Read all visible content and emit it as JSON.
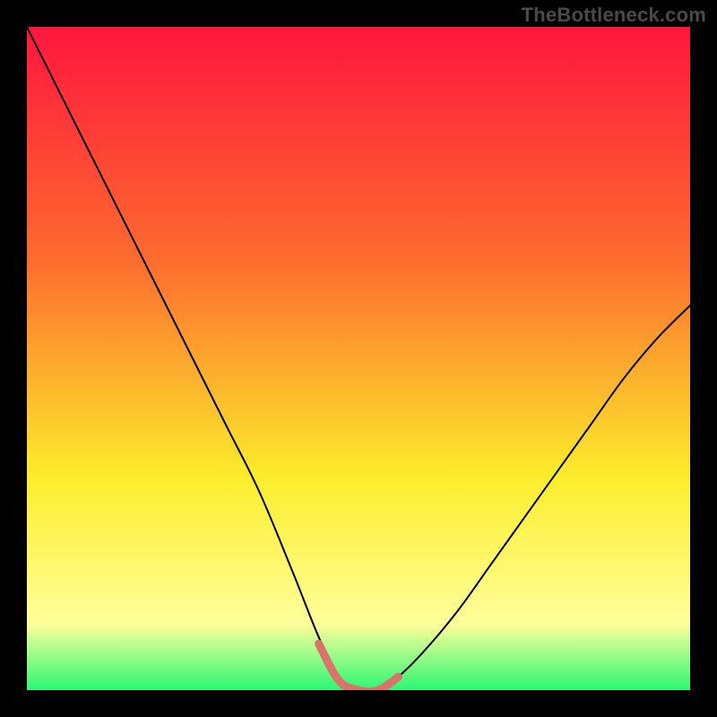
{
  "watermark": "TheBottleneck.com",
  "colors": {
    "background_frame": "#000000",
    "gradient_top": "#ff163e",
    "gradient_mid1": "#fd6b2f",
    "gradient_mid2": "#fced2c",
    "gradient_bottom_yellow": "#ffff9b",
    "gradient_bottom_green": "#2cf774",
    "curve_stroke": "#000000",
    "marker_stroke": "#d9736b"
  },
  "chart_data": {
    "type": "line",
    "title": "",
    "xlabel": "",
    "ylabel": "",
    "xlim": [
      0,
      100
    ],
    "ylim": [
      0,
      100
    ],
    "grid": false,
    "legend": false,
    "series": [
      {
        "name": "bottleneck-curve",
        "x": [
          0,
          5,
          10,
          15,
          20,
          25,
          30,
          35,
          40,
          44,
          47,
          50,
          53,
          56,
          60,
          65,
          70,
          75,
          80,
          85,
          90,
          95,
          100
        ],
        "y": [
          100,
          90,
          80,
          70,
          60,
          50,
          40,
          30,
          18,
          8,
          2,
          0,
          0,
          2,
          6,
          12,
          19,
          26,
          33,
          40,
          47,
          53,
          58
        ]
      }
    ],
    "annotations": [
      {
        "name": "optimal-range-marker",
        "x": [
          44,
          47,
          50,
          53,
          56
        ],
        "y": [
          7,
          1.5,
          0,
          0,
          2
        ],
        "stroke": "#d9736b"
      }
    ],
    "background_gradient": {
      "stops": [
        {
          "offset": 0.0,
          "color": "#ff163e"
        },
        {
          "offset": 0.35,
          "color": "#fd6b2f"
        },
        {
          "offset": 0.68,
          "color": "#fced2c"
        },
        {
          "offset": 0.9,
          "color": "#ffff9b"
        },
        {
          "offset": 1.0,
          "color": "#2cf774"
        }
      ]
    }
  }
}
